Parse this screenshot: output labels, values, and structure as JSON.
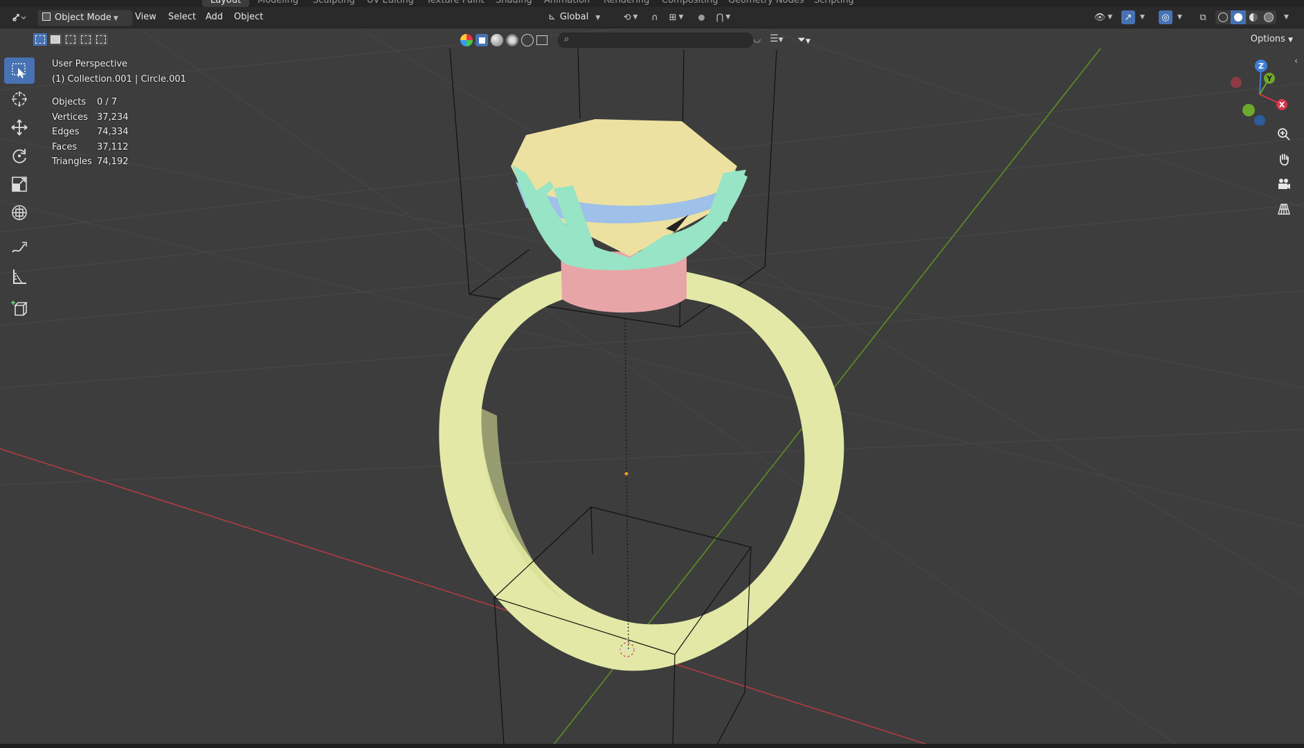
{
  "workspace_tabs": [
    "Layout",
    "Modeling",
    "Sculpting",
    "UV Editing",
    "Texture Paint",
    "Shading",
    "Animation",
    "Rendering",
    "Compositing",
    "Geometry Nodes",
    "Scripting"
  ],
  "header": {
    "mode": "Object Mode",
    "menus": [
      "View",
      "Select",
      "Add",
      "Object"
    ],
    "transform_orientation": "Global",
    "options_label": "Options"
  },
  "search": {
    "placeholder": ""
  },
  "viewport_info": {
    "view_name": "User Perspective",
    "collection": "(1) Collection.001 | Circle.001"
  },
  "stats": [
    {
      "label": "Objects",
      "value": "0 / 7"
    },
    {
      "label": "Vertices",
      "value": "37,234"
    },
    {
      "label": "Edges",
      "value": "74,334"
    },
    {
      "label": "Faces",
      "value": "37,112"
    },
    {
      "label": "Triangles",
      "value": "74,192"
    }
  ],
  "gizmo_axes": {
    "x": "X",
    "y": "Y",
    "z": "Z"
  },
  "colors": {
    "accent": "#4772b3",
    "ring_band": "#e3e8a6",
    "gem_top": "#ece1a0",
    "gem_band": "#9fc0e8",
    "prongs": "#97e4c6",
    "setting_base": "#e8a5a7",
    "axis_x": "#c2424a",
    "axis_y": "#6a9a2a"
  },
  "tools": [
    "select-box-tool",
    "cursor-tool",
    "move-tool",
    "rotate-tool",
    "scale-tool",
    "transform-tool",
    "annotate-tool",
    "measure-tool",
    "add-cube-tool"
  ]
}
